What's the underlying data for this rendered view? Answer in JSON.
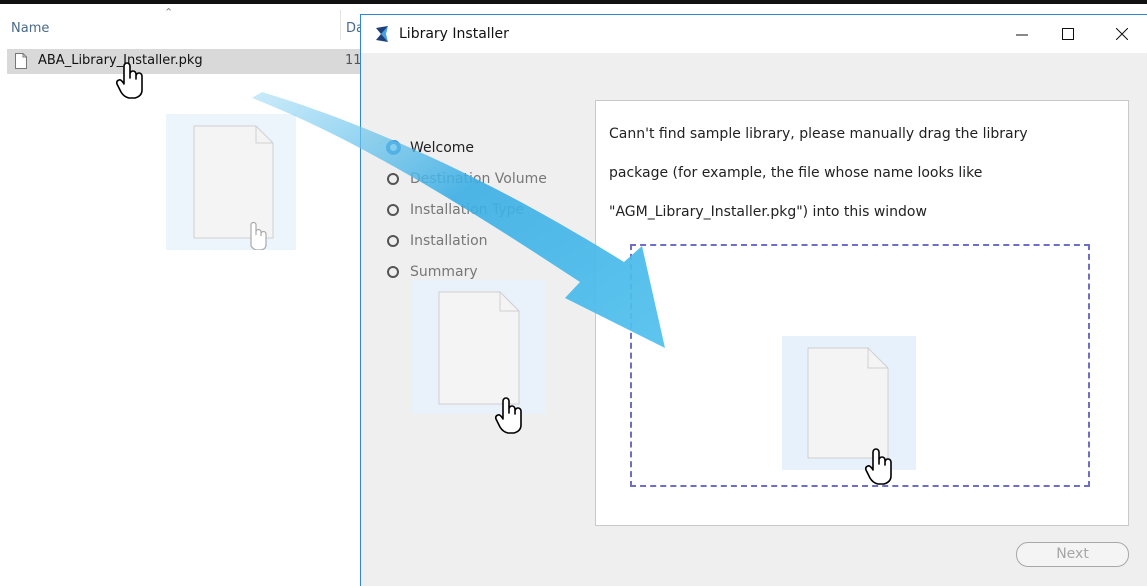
{
  "explorer": {
    "columns": {
      "name": "Name",
      "date_partial": "Da"
    },
    "file": {
      "name": "ABA_Library_Installer.pkg",
      "date_partial": "11"
    }
  },
  "window": {
    "title": "Library Installer",
    "buttons": {
      "minimize": "minimize-icon",
      "maximize": "maximize-icon",
      "close": "close-icon"
    },
    "steps": [
      {
        "label": "Welcome",
        "active": true
      },
      {
        "label": "Destination Volume",
        "active": false
      },
      {
        "label": "Installation Type",
        "active": false
      },
      {
        "label": "Installation",
        "active": false
      },
      {
        "label": "Summary",
        "active": false
      }
    ],
    "message_lines": [
      "Cann't find sample library, please manually drag the library",
      "package (for example, the file whose name looks like",
      "\"AGM_Library_Installer.pkg\") into this window"
    ],
    "next_label": "Next"
  },
  "colors": {
    "accent": "#2b8ad8",
    "arrow": "#4bb6e6",
    "drop_border": "#6e6ec4"
  }
}
